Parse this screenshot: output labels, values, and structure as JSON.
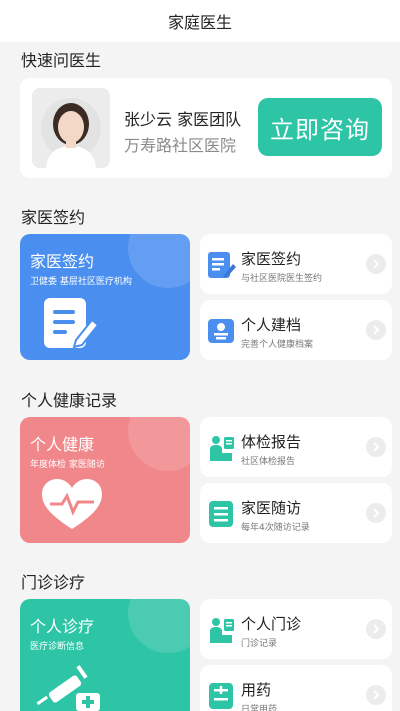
{
  "header": {
    "title": "家庭医生"
  },
  "quick": {
    "section_title": "快速问医生",
    "doctor_name": "张少云 家医团队",
    "hospital": "万寿路社区医院",
    "consult_label": "立即咨询"
  },
  "sign": {
    "section_title": "家医签约",
    "big": {
      "title": "家医签约",
      "subtitle": "卫健委 基层社区医疗机构",
      "color": "#4a8ff0"
    },
    "items": [
      {
        "title": "家医签约",
        "subtitle": "与社区医院医生签约",
        "icon": "sign-document-icon"
      },
      {
        "title": "个人建档",
        "subtitle": "完善个人健康档案",
        "icon": "profile-folder-icon"
      }
    ]
  },
  "health": {
    "section_title": "个人健康记录",
    "big": {
      "title": "个人健康",
      "subtitle": "年度体检 家医随访",
      "color": "#f0878a"
    },
    "items": [
      {
        "title": "体检报告",
        "subtitle": "社区体检报告",
        "icon": "doctor-exam-icon"
      },
      {
        "title": "家医随访",
        "subtitle": "每年4次随访记录",
        "icon": "followup-checklist-icon"
      }
    ]
  },
  "clinic": {
    "section_title": "门诊诊疗",
    "big": {
      "title": "个人诊疗",
      "subtitle": "医疗诊断信息",
      "color": "#2ec4a6"
    },
    "items": [
      {
        "title": "个人门诊",
        "subtitle": "门诊记录",
        "icon": "doctor-clinic-icon"
      },
      {
        "title": "用药",
        "subtitle": "日常用药",
        "icon": "medicine-list-icon"
      }
    ]
  },
  "colors": {
    "accent": "#2ec4a6",
    "blue": "#4a8ff0",
    "pink": "#f0878a",
    "icon_blue": "#4a8ff0"
  }
}
